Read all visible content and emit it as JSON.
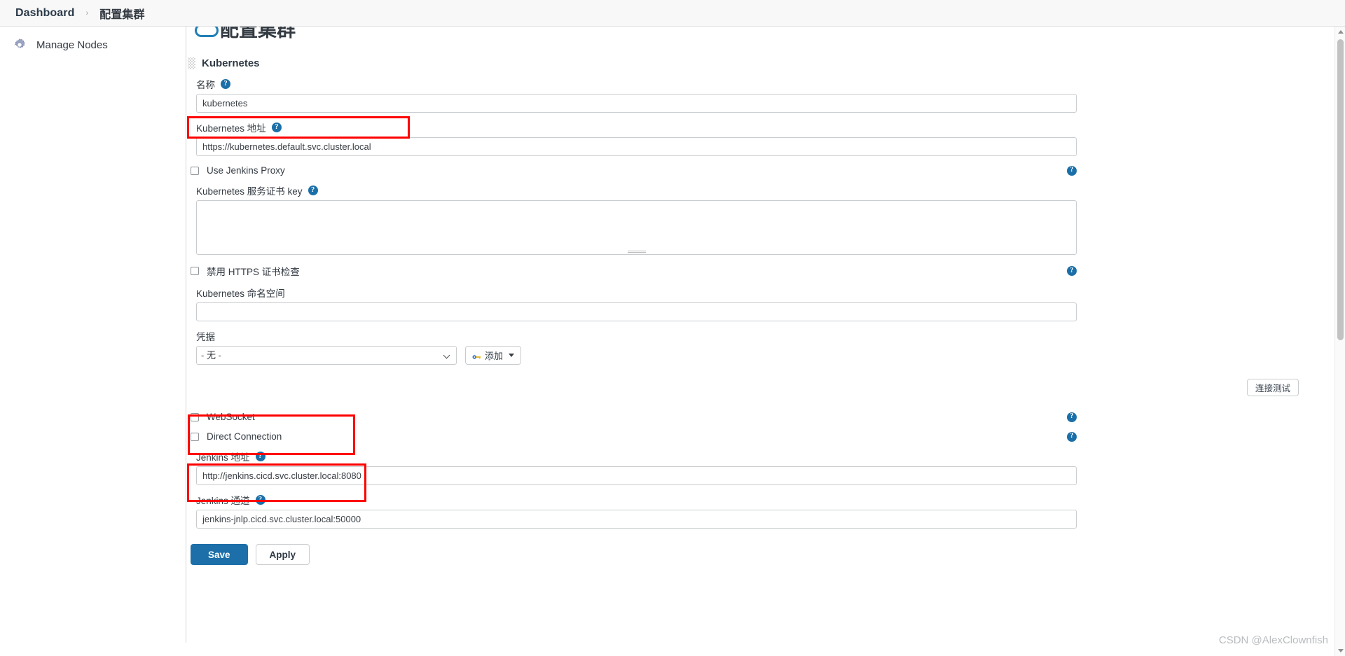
{
  "breadcrumb": {
    "dashboard": "Dashboard",
    "separator": "›",
    "current": "配置集群"
  },
  "sidebar": {
    "items": [
      {
        "label": "Manage Nodes",
        "icon": "gear-icon"
      }
    ]
  },
  "page": {
    "cut_off_heading": "配置集群"
  },
  "form": {
    "section_title": "Kubernetes",
    "help_glyph": "?",
    "name": {
      "label": "名称",
      "value": "kubernetes",
      "placeholder": ""
    },
    "k8s_url": {
      "label": "Kubernetes 地址",
      "value": "https://kubernetes.default.svc.cluster.local",
      "placeholder": ""
    },
    "use_jenkins_proxy": {
      "label": "Use Jenkins Proxy",
      "checked": false
    },
    "server_cert_key": {
      "label": "Kubernetes 服务证书 key",
      "value": "",
      "placeholder": ""
    },
    "disable_https_check": {
      "label": "禁用 HTTPS 证书检查",
      "checked": false
    },
    "namespace": {
      "label": "Kubernetes 命名空间",
      "value": "",
      "placeholder": ""
    },
    "credentials": {
      "label": "凭据",
      "selected": "- 无 -",
      "options": [
        "- 无 -"
      ],
      "add_button": "添加"
    },
    "connection_test_button": "连接测试",
    "websocket": {
      "label": "WebSocket",
      "checked": false
    },
    "direct_connection": {
      "label": "Direct Connection",
      "checked": false
    },
    "jenkins_url": {
      "label": "Jenkins 地址",
      "value": "http://jenkins.cicd.svc.cluster.local:8080",
      "placeholder": ""
    },
    "jenkins_tunnel": {
      "label": "Jenkins 通道",
      "value": "jenkins-jnlp.cicd.svc.cluster.local:50000",
      "placeholder": ""
    },
    "save_button": "Save",
    "apply_button": "Apply"
  },
  "watermark": "CSDN @AlexClownfish",
  "colors": {
    "accent": "#1c6fa8",
    "help_icon": "#1b6fa8",
    "annotation": "#ff0000",
    "text": "#333a42"
  }
}
